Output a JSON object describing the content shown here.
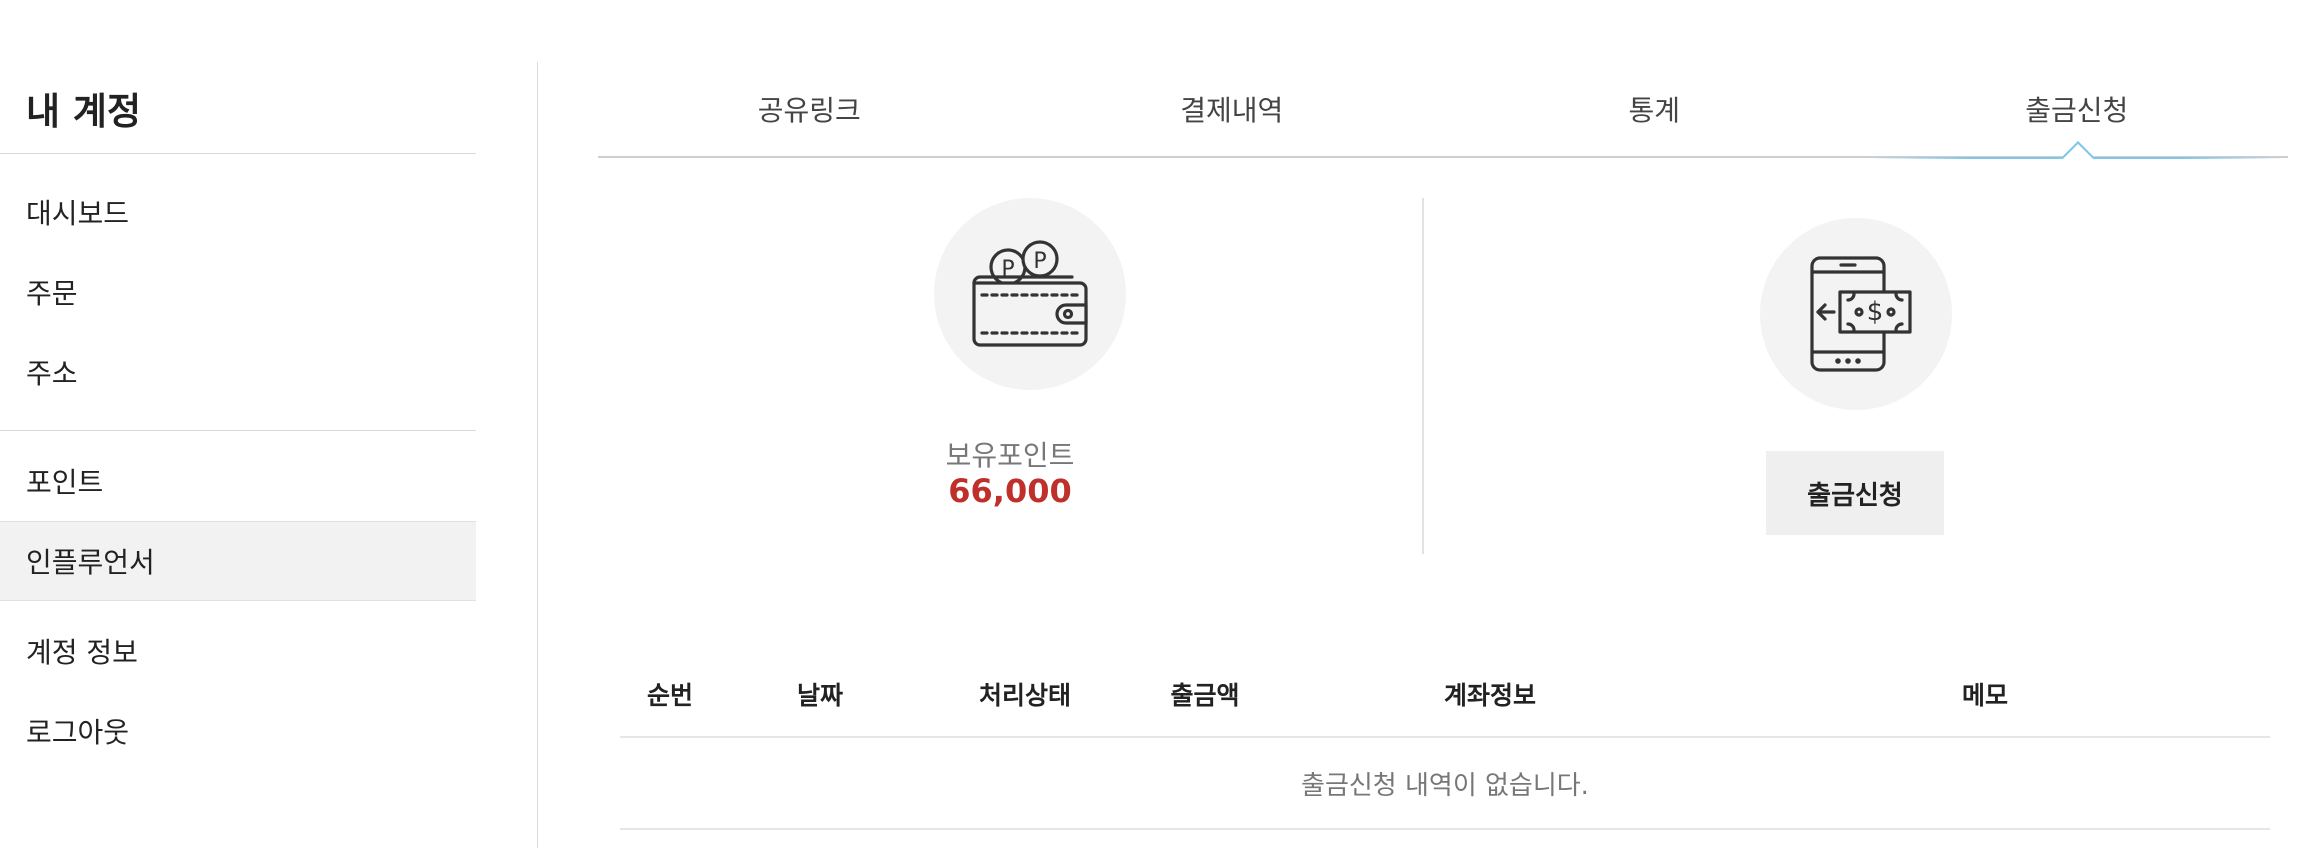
{
  "sidebar": {
    "title": "내 계정",
    "groups": [
      [
        {
          "label": "대시보드"
        },
        {
          "label": "주문"
        },
        {
          "label": "주소"
        }
      ],
      [
        {
          "label": "포인트"
        },
        {
          "label": "인플루언서",
          "active": true
        }
      ],
      [
        {
          "label": "계정 정보"
        },
        {
          "label": "로그아웃"
        }
      ]
    ]
  },
  "tabs": [
    {
      "label": "공유링크"
    },
    {
      "label": "결제내역"
    },
    {
      "label": "통계"
    },
    {
      "label": "출금신청",
      "active": true
    }
  ],
  "summary": {
    "points_icon": "wallet-points-icon",
    "points_label": "보유포인트",
    "points_value": "66,000",
    "points_value_color": "#c0302a",
    "withdraw_icon": "phone-money-transfer-icon",
    "withdraw_button": "출금신청"
  },
  "table": {
    "headers": [
      "순번",
      "날짜",
      "처리상태",
      "출금액",
      "계좌정보",
      "메모"
    ],
    "empty_message": "출금신청 내역이 없습니다."
  },
  "colors": {
    "accent_tab": "#7cc6ea",
    "active_row_bg": "#f2f2f2"
  }
}
